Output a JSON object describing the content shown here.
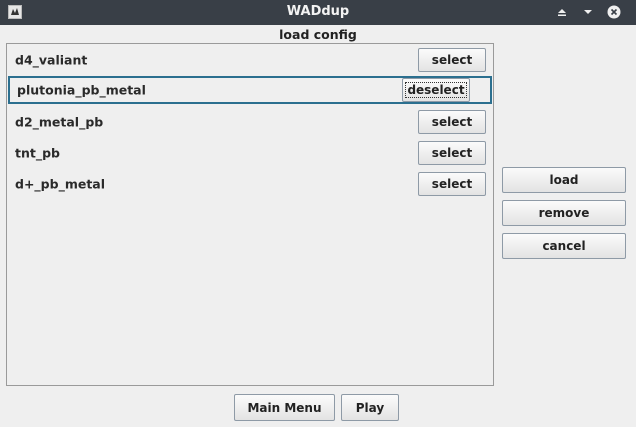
{
  "window": {
    "title": "WADdup",
    "icons": {
      "app": "doom-wad-icon",
      "shade": "shade-icon",
      "minimize": "minimize-icon",
      "close": "close-icon"
    }
  },
  "dialog": {
    "heading": "load config"
  },
  "configs": [
    {
      "name": "d4_valiant",
      "action": "select",
      "selected": false
    },
    {
      "name": "plutonia_pb_metal",
      "action": "deselect",
      "selected": true
    },
    {
      "name": "d2_metal_pb",
      "action": "select",
      "selected": false
    },
    {
      "name": "tnt_pb",
      "action": "select",
      "selected": false
    },
    {
      "name": "d+_pb_metal",
      "action": "select",
      "selected": false
    }
  ],
  "side_buttons": {
    "load": "load",
    "remove": "remove",
    "cancel": "cancel"
  },
  "bottom_buttons": {
    "main_menu": "Main Menu",
    "play": "Play"
  },
  "colors": {
    "titlebar": "#393f47",
    "selection_border": "#2b6f8f",
    "background": "#efefef"
  }
}
